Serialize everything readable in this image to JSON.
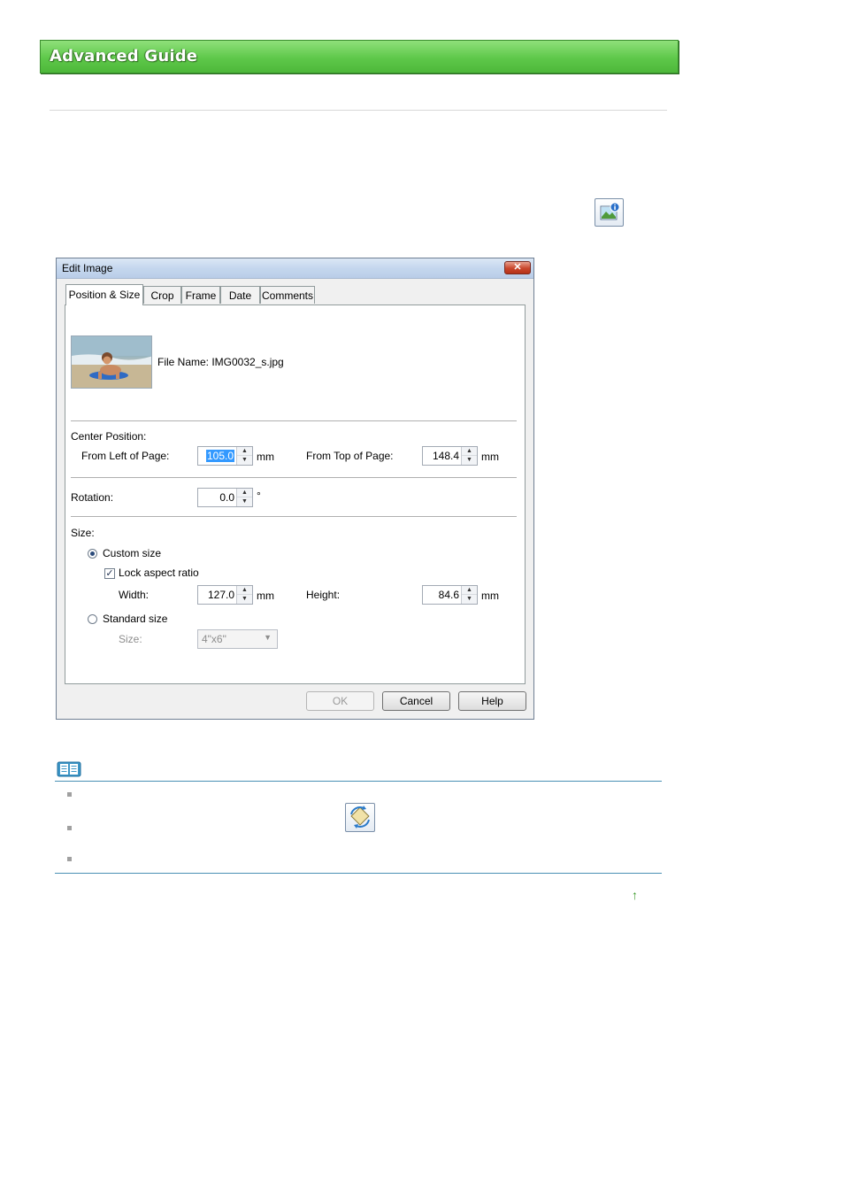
{
  "banner": {
    "title": "Advanced Guide"
  },
  "dialog": {
    "title": "Edit Image",
    "close_glyph": "✕",
    "tabs": [
      {
        "label": "Position & Size",
        "active": true
      },
      {
        "label": "Crop"
      },
      {
        "label": "Frame"
      },
      {
        "label": "Date"
      },
      {
        "label": "Comments"
      }
    ],
    "file_name": "File Name:  IMG0032_s.jpg",
    "center_position": {
      "heading": "Center Position:",
      "left_label": "From Left of Page:",
      "left_value": "105.0",
      "left_unit": "mm",
      "top_label": "From Top of Page:",
      "top_value": "148.4",
      "top_unit": "mm"
    },
    "rotation": {
      "label": "Rotation:",
      "value": "0.0",
      "unit": "°"
    },
    "size": {
      "heading": "Size:",
      "custom_label": "Custom size",
      "custom_selected": true,
      "lock_label": "Lock aspect ratio",
      "lock_checked": true,
      "width_label": "Width:",
      "width_value": "127.0",
      "width_unit": "mm",
      "height_label": "Height:",
      "height_value": "84.6",
      "height_unit": "mm",
      "standard_label": "Standard size",
      "standard_selected": false,
      "std_size_label": "Size:",
      "std_size_value": "4\"x6\""
    },
    "buttons": {
      "ok": "OK",
      "cancel": "Cancel",
      "help": "Help"
    }
  },
  "spinner_arrows": {
    "up": "▲",
    "down": "▼"
  },
  "combo_arrow": "▼",
  "check_glyph": "✓",
  "top_arrow": "↑",
  "icons": [
    "image-info-icon",
    "note-book-icon",
    "rotate-image-icon",
    "back-to-top-icon"
  ],
  "colors": {
    "banner_green": "#5ec84a",
    "note_line": "#4a91b5",
    "selection": "#3399ff"
  }
}
